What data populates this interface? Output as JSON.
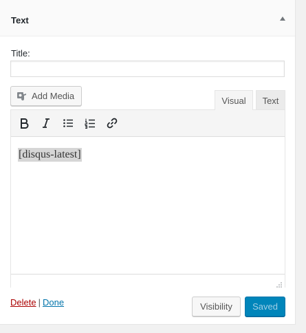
{
  "widget": {
    "title": "Text"
  },
  "form": {
    "title_label": "Title:",
    "title_value": "",
    "title_placeholder": ""
  },
  "editor": {
    "add_media_label": "Add Media",
    "tabs": [
      {
        "label": "Visual",
        "active": true
      },
      {
        "label": "Text",
        "active": false
      }
    ],
    "toolbar": [
      "bold-icon",
      "italic-icon",
      "bulleted-list-icon",
      "numbered-list-icon",
      "link-icon"
    ],
    "content": "[disqus-latest]"
  },
  "actions": {
    "delete_label": "Delete",
    "separator": "|",
    "done_label": "Done",
    "visibility_label": "Visibility",
    "save_label": "Saved"
  },
  "colors": {
    "accent": "#0085ba",
    "delete": "#aa0000",
    "link": "#0073aa"
  }
}
